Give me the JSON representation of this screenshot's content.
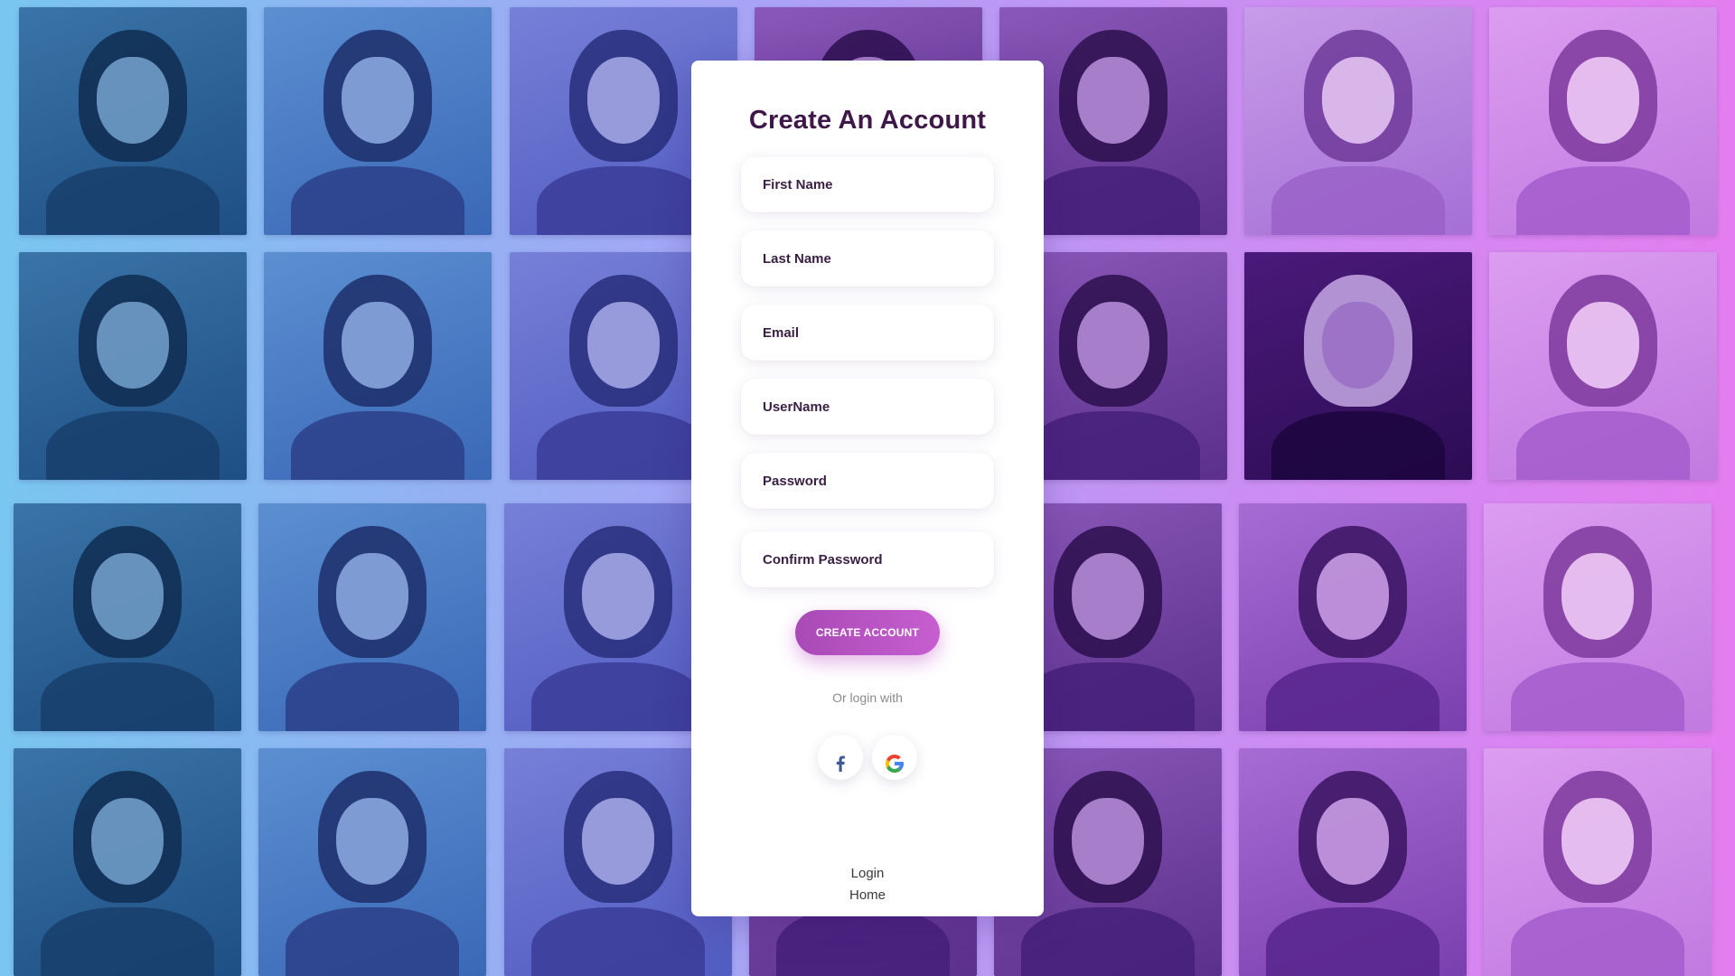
{
  "form": {
    "title": "Create An Account",
    "fields": [
      {
        "placeholder": "First Name",
        "value": ""
      },
      {
        "placeholder": "Last Name",
        "value": ""
      },
      {
        "placeholder": "Email",
        "value": ""
      },
      {
        "placeholder": "UserName",
        "value": ""
      },
      {
        "placeholder": "Password",
        "value": ""
      },
      {
        "placeholder": "Confirm Password",
        "value": ""
      }
    ],
    "submit_label": "CREATE ACCOUNT",
    "or_text": "Or login with",
    "social": [
      {
        "icon": "facebook-icon",
        "color": "#3b5998"
      },
      {
        "icon": "google-icon",
        "colors": [
          "#4285F4",
          "#EA4335",
          "#FBBC05",
          "#34A853"
        ]
      }
    ],
    "links": {
      "login": "Login",
      "home": "Home"
    }
  },
  "theme": {
    "background_gradient": [
      "#79c6f0",
      "#a4a6f5",
      "#c98ff2",
      "#e47ef0"
    ],
    "button_color": "#b450be",
    "title_color": "#3e1848"
  },
  "background": {
    "photo_tiles": 28
  }
}
